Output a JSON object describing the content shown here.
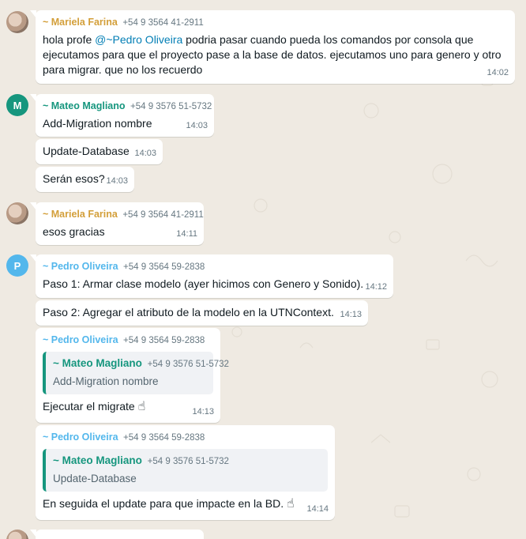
{
  "messages": [
    {
      "sender": "~ Mariela Farina",
      "phone": "+54 9 3564 41-2911",
      "text_before": "hola profe ",
      "mention": "@~Pedro Oliveira",
      "text_line1_after": " podria pasar cuando pueda los comandos por consola que",
      "text_line2": "ejecutamos para que el proyecto pase a la base de datos. ejecutamos uno para genero y otro",
      "text_line3": "para migrar. que no los recuerdo",
      "time": "14:02"
    },
    {
      "avatar_letter": "M",
      "sender": "~ Mateo Magliano",
      "phone": "+54 9 3576 51-5732",
      "text": "Add-Migration nombre",
      "time": "14:03"
    },
    {
      "text": "Update-Database",
      "time": "14:03"
    },
    {
      "text": "Serán esos?",
      "time": "14:03"
    },
    {
      "sender": "~ Mariela Farina",
      "phone": "+54 9 3564 41-2911",
      "text": "esos gracias",
      "time": "14:11"
    },
    {
      "avatar_letter": "P",
      "sender": "~ Pedro Oliveira",
      "phone": "+54 9 3564 59-2838",
      "text": "Paso 1: Armar clase modelo (ayer hicimos con Genero y Sonido).",
      "time": "14:12"
    },
    {
      "text": "Paso 2: Agregar el atributo de la modelo en la UTNContext.",
      "time": "14:13"
    },
    {
      "sender": "~ Pedro Oliveira",
      "phone": "+54 9 3564 59-2838",
      "quote": {
        "sender": "~ Mateo Magliano",
        "phone": "+54 9 3576 51-5732",
        "text": "Add-Migration nombre"
      },
      "text": "Ejecutar el migrate",
      "emoji": "☝",
      "time": "14:13"
    },
    {
      "sender": "~ Pedro Oliveira",
      "phone": "+54 9 3564 59-2838",
      "quote": {
        "sender": "~ Mateo Magliano",
        "phone": "+54 9 3576 51-5732",
        "text": "Update-Database"
      },
      "text": "En seguida el update para que impacte en la BD.",
      "emoji": "☝",
      "time": "14:14"
    }
  ],
  "colors": {
    "background": "#efeae2",
    "bubble": "#ffffff",
    "mariela": "#d39f3a",
    "mateo": "#16967e",
    "pedro": "#53b7ec",
    "mention": "#027eb5",
    "timestamp": "#667781"
  },
  "icons": [
    "avatar-photo",
    "pointing-up-emoji"
  ]
}
